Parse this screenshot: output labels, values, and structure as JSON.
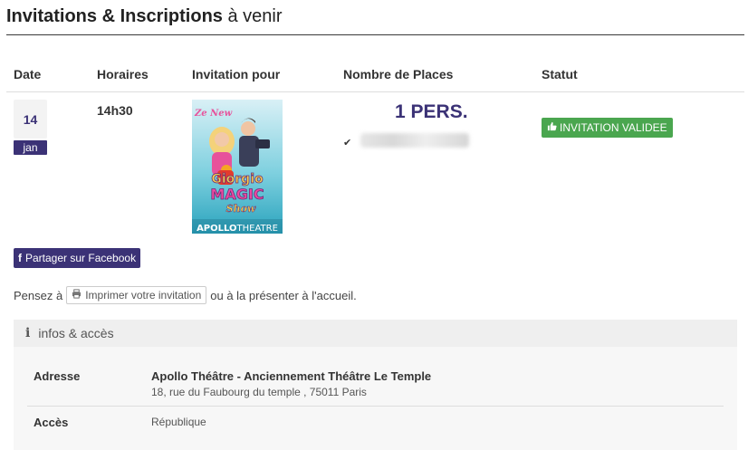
{
  "header": {
    "title_bold": "Invitations & Inscriptions",
    "title_rest": " à venir"
  },
  "table": {
    "columns": [
      "Date",
      "Horaires",
      "Invitation pour",
      "Nombre de Places",
      "Statut"
    ],
    "row": {
      "day": "14",
      "month": "jan",
      "time": "14h30",
      "poster": {
        "line1": "Ze New",
        "line2": "Giorgio",
        "line3": "MAGIC",
        "line4": "Show",
        "venue_bold": "APOLLO",
        "venue_light": "THEATRE"
      },
      "places": "1 PERS.",
      "check_icon": "check-icon",
      "status": "INVITATION VALIDEE",
      "status_icon": "thumbs-up-icon",
      "status_color": "#4aa64f"
    }
  },
  "actions": {
    "facebook_label": "Partager sur Facebook",
    "notice_before": "Pensez à",
    "print_label": "Imprimer votre invitation",
    "notice_after": "ou à la présenter à l'accueil."
  },
  "info": {
    "header": "infos & accès",
    "address_label": "Adresse",
    "address_name": "Apollo Théâtre - Anciennement Théâtre Le Temple",
    "address_line": "18, rue du Faubourg du temple , 75011 Paris",
    "access_label": "Accès",
    "access_value": "République"
  },
  "colors": {
    "brand": "#3b3276",
    "success": "#4aa64f"
  }
}
